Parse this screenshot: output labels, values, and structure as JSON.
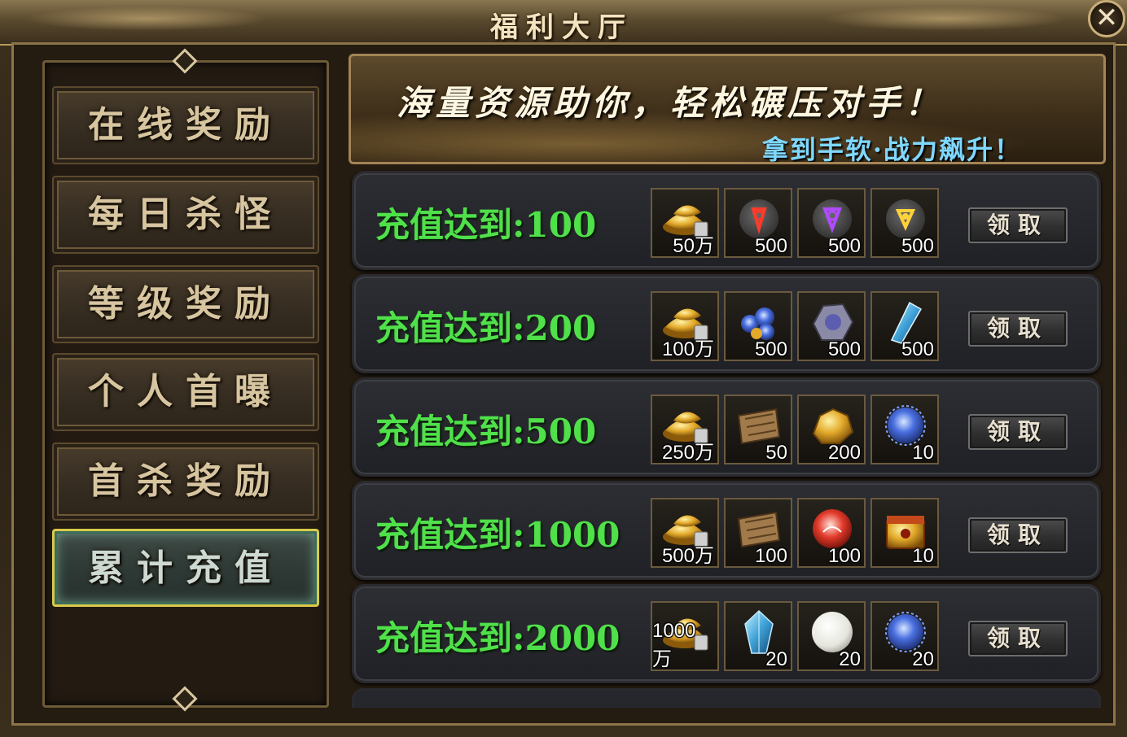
{
  "window": {
    "title": "福利大厅",
    "close_glyph": "✕"
  },
  "sidebar": {
    "items": [
      {
        "label": "在线奖励",
        "active": false
      },
      {
        "label": "每日杀怪",
        "active": false
      },
      {
        "label": "等级奖励",
        "active": false
      },
      {
        "label": "个人首曝",
        "active": false
      },
      {
        "label": "首杀奖励",
        "active": false
      },
      {
        "label": "累计充值",
        "active": true
      }
    ]
  },
  "banner": {
    "main_text": "海量资源助你，轻松碾压对手！",
    "sub_text": "拿到手软·战力飙升！"
  },
  "rows": [
    {
      "label": "充值达到:100",
      "claim": "领取",
      "rewards": [
        {
          "icon": "gold-ingot-icon",
          "qty": "50万"
        },
        {
          "icon": "red-rune-stone-icon",
          "qty": "500"
        },
        {
          "icon": "purple-rune-stone-icon",
          "qty": "500"
        },
        {
          "icon": "gold-rune-stone-icon",
          "qty": "500"
        }
      ]
    },
    {
      "label": "充值达到:200",
      "claim": "领取",
      "rewards": [
        {
          "icon": "gold-ingot-icon",
          "qty": "100万"
        },
        {
          "icon": "blue-crystal-cluster-icon",
          "qty": "500"
        },
        {
          "icon": "grey-ore-icon",
          "qty": "500"
        },
        {
          "icon": "ice-shard-icon",
          "qty": "500"
        }
      ]
    },
    {
      "label": "充值达到:500",
      "claim": "领取",
      "rewards": [
        {
          "icon": "gold-ingot-icon",
          "qty": "250万"
        },
        {
          "icon": "scroll-icon",
          "qty": "50"
        },
        {
          "icon": "gold-nugget-icon",
          "qty": "200"
        },
        {
          "icon": "blue-orb-icon",
          "qty": "10"
        }
      ]
    },
    {
      "label": "充值达到:1000",
      "claim": "领取",
      "rewards": [
        {
          "icon": "gold-ingot-icon",
          "qty": "500万"
        },
        {
          "icon": "scroll-icon",
          "qty": "100"
        },
        {
          "icon": "red-orb-icon",
          "qty": "100"
        },
        {
          "icon": "treasure-box-icon",
          "qty": "10"
        }
      ]
    },
    {
      "label": "充值达到:2000",
      "claim": "领取",
      "rewards": [
        {
          "icon": "gold-ingot-icon",
          "qty": "1000万"
        },
        {
          "icon": "blue-crystal-icon",
          "qty": "20"
        },
        {
          "icon": "white-pearl-icon",
          "qty": "20"
        },
        {
          "icon": "blue-orb-icon",
          "qty": "20"
        }
      ]
    }
  ],
  "colors": {
    "row_label": "#4fe04a",
    "active_border": "#d9c94a",
    "banner_sub": "#7fd8ff"
  }
}
